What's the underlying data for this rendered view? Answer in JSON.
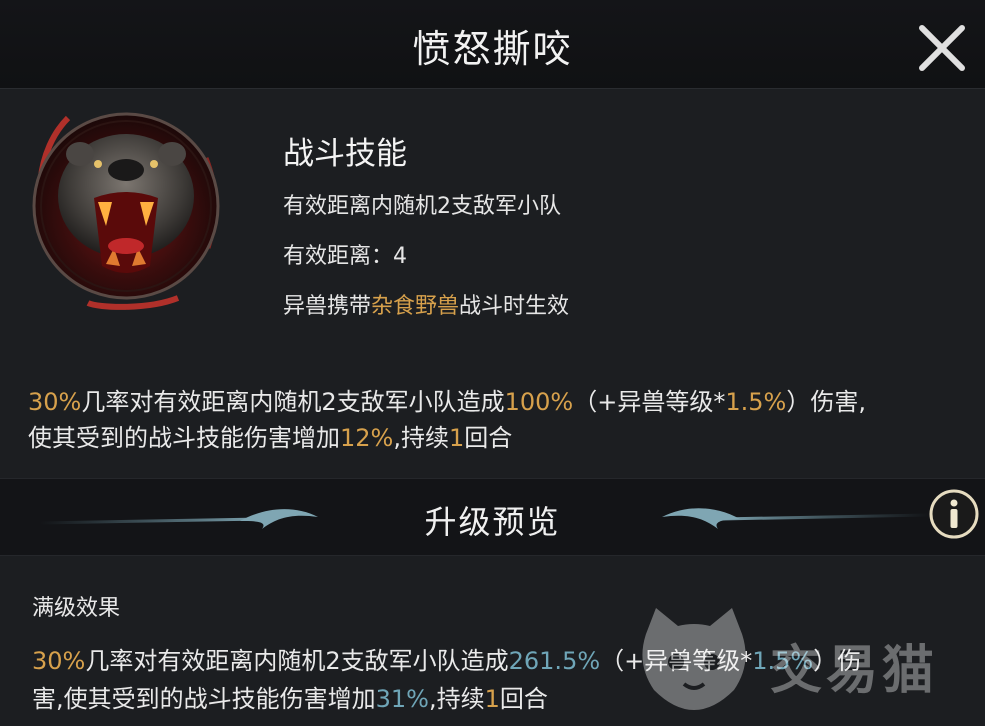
{
  "header": {
    "title": "愤怒撕咬",
    "close_icon": "close-icon"
  },
  "skill": {
    "type": "战斗技能",
    "target": "有效距离内随机2支敌军小队",
    "range_label": "有效距离：",
    "range_value": "4",
    "condition_prefix": "异兽携带",
    "condition_highlight": "杂食野兽",
    "condition_suffix": "战斗时生效",
    "portrait_icon": "bear-portrait-icon"
  },
  "description": {
    "chance": "30%",
    "t1": "几率对有效距离内随机2支敌军小队造成",
    "damage": "100%",
    "t2": "（+异兽等级*",
    "scaling": "1.5%",
    "t3": "）伤害,",
    "t4": "使其受到的战斗技能伤害增加",
    "increase": "12%",
    "t5": ",持续",
    "turns": "1",
    "t6": "回合"
  },
  "upgrade": {
    "title": "升级预览",
    "info_icon": "info-icon"
  },
  "max_level": {
    "label": "满级效果",
    "chance": "30%",
    "t1": "几率对有效距离内随机2支敌军小队造成",
    "damage": "261.5%",
    "t2": "（+异兽等级*",
    "scaling": "1.5%",
    "t3": "）伤",
    "t4": "害,使其受到的战斗技能伤害增加",
    "increase": "31%",
    "t5": ",持续",
    "turns": "1",
    "t6": "回合"
  },
  "watermark": {
    "text": "交易猫",
    "icon": "cat-logo-icon"
  },
  "colors": {
    "gold": "#d7a14c",
    "teal": "#6fa6b8",
    "background": "#1c1e21"
  }
}
